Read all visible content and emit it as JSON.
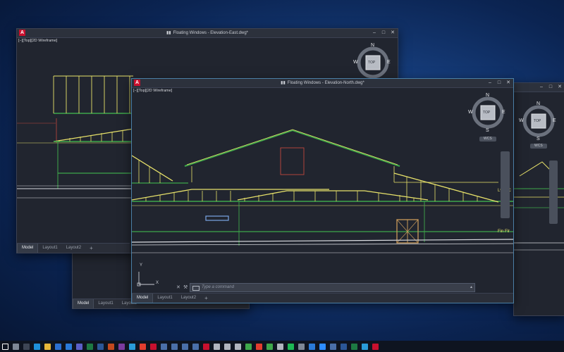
{
  "windows": {
    "east": {
      "app_icon": "A",
      "title": "Floating Windows - Elevation-East.dwg*",
      "viewport_label": "[−][Top][2D Wireframe]",
      "tabs": [
        "Model",
        "Layout1",
        "Layout2",
        "+"
      ]
    },
    "north": {
      "app_icon": "A",
      "title": "Floating Windows - Elevation-North.dwg*",
      "viewport_label": "[−][Top][2D Wireframe]",
      "tabs": [
        "Model",
        "Layout1",
        "Layout2",
        "+"
      ],
      "annotations": {
        "level1": "Lvl 1 C",
        "fin_flr": "Fin Flr"
      },
      "command_placeholder": "Type a command",
      "ucs_y": "Y",
      "ucs_x": "X"
    },
    "back": {
      "tabs": [
        "Model",
        "Layout1",
        "Layout2"
      ]
    },
    "right": {}
  },
  "compass": {
    "n": "N",
    "s": "S",
    "e": "E",
    "w": "W",
    "cube_face": "TOP",
    "wcs": "WCS"
  },
  "window_controls": {
    "min": "–",
    "max": "□",
    "close": "✕"
  },
  "colors": {
    "accent_red": "#c8102e",
    "yellow": "#e8e26a",
    "green": "#3ea84b",
    "red_line": "#c0463e",
    "white_line": "#d9dbe0"
  },
  "taskbar": {
    "icons": [
      "windows-icon",
      "search-icon",
      "task-view-icon",
      "edge-icon",
      "explorer-icon",
      "store-icon",
      "mail-icon",
      "teams-icon",
      "excel-icon",
      "word-icon",
      "powerpoint-icon",
      "onenote-icon",
      "photos-icon",
      "chrome-icon",
      "autocad-icon",
      "app-icon-b1",
      "app-icon-b2",
      "app-icon-b3",
      "app-icon-b4",
      "autocad-active-icon",
      "app-icon-a1",
      "app-icon-r",
      "app-icon-a2",
      "app-icon-c",
      "app-icon-pdf",
      "app-icon-g",
      "app-icon-a3",
      "spotify-icon",
      "app-icon-n",
      "app-icon-s",
      "zoom-icon",
      "app-icon-2",
      "app-icon-w",
      "app-icon-x",
      "app-icon-m",
      "app-icon-red"
    ]
  }
}
